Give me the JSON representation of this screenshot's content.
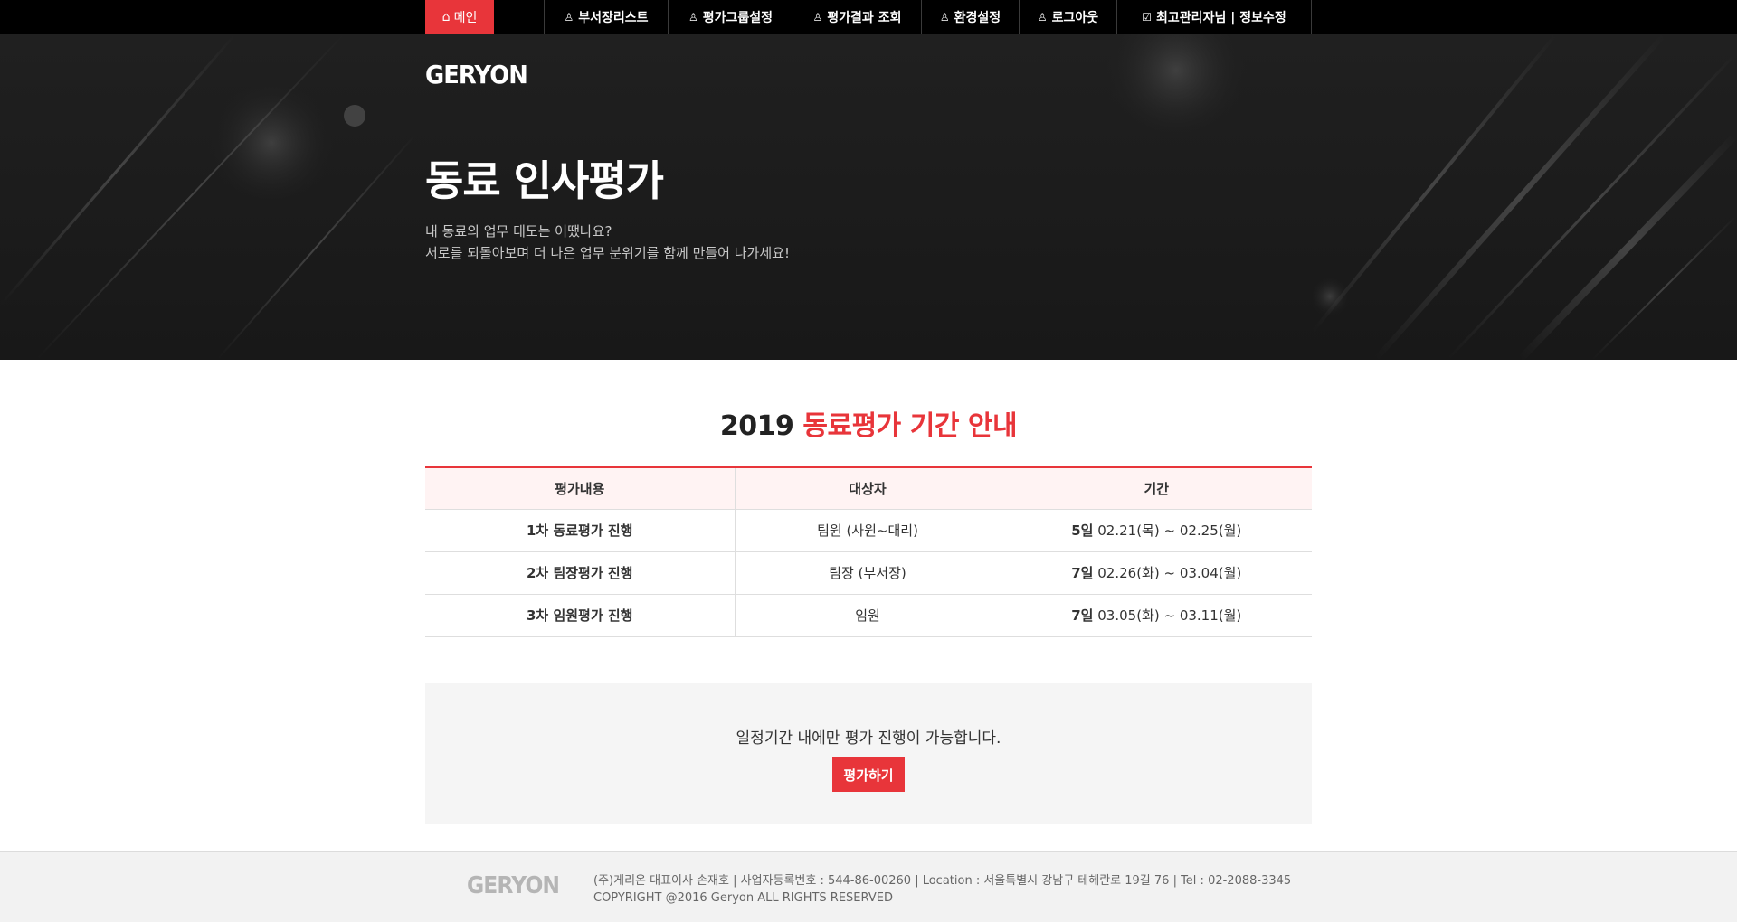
{
  "nav": {
    "home": "메인",
    "items": [
      {
        "label": "부서장리스트",
        "icon": "user-icon"
      },
      {
        "label": "평가그룹설정",
        "icon": "user-icon"
      },
      {
        "label": "평가결과 조회",
        "icon": "user-icon"
      },
      {
        "label": "환경설정",
        "icon": "user-icon"
      },
      {
        "label": "로그아웃",
        "icon": "user-icon"
      },
      {
        "label": "최고관리자님 | 정보수정",
        "icon": "clipboard-icon"
      }
    ]
  },
  "hero": {
    "logo": "GERYON",
    "title": "동료 인사평가",
    "subtitle_line1": "내 동료의 업무 태도는 어땠나요?",
    "subtitle_line2": "서로를 되돌아보며 더 나은 업무 분위기를 함께 만들어 나가세요!"
  },
  "schedule": {
    "title_year": "2019",
    "title_rest": "동료평가 기간 안내",
    "headers": [
      "평가내용",
      "대상자",
      "기간"
    ],
    "rows": [
      {
        "content": "1차 동료평가 진행",
        "target": "팀원 (사원~대리)",
        "days": "5일",
        "range": "02.21(목) ~ 02.25(월)"
      },
      {
        "content": "2차 팀장평가 진행",
        "target": "팀장 (부서장)",
        "days": "7일",
        "range": "02.26(화) ~ 03.04(월)"
      },
      {
        "content": "3차 임원평가 진행",
        "target": "임원",
        "days": "7일",
        "range": "03.05(화) ~ 03.11(월)"
      }
    ]
  },
  "notice": {
    "text": "일정기간 내에만 평가 진행이 가능합니다.",
    "button": "평가하기"
  },
  "footer": {
    "logo": "GERYON",
    "line1": "(주)게리온 대표이사 손재호 | 사업자등록번호 : 544-86-00260 | Location : 서울특별시 강남구 테헤란로 19길 76 | Tel : 02-2088-3345",
    "line2": "COPYRIGHT @2016 Geryon ALL RIGHTS RESERVED"
  },
  "colors": {
    "accent": "#e8353a",
    "nav_bg": "#000000",
    "hero_bg": "#1c1c1c"
  }
}
